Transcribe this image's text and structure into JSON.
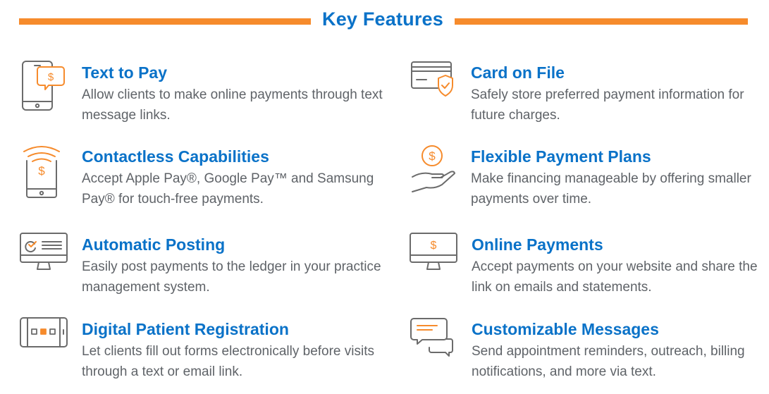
{
  "colors": {
    "accent": "#f68b2c",
    "brand": "#0a72c8",
    "text": "#5f6368",
    "icon_gray": "#6b6b6b"
  },
  "header": {
    "title": "Key Features"
  },
  "features": [
    {
      "icon": "phone-chat-dollar-icon",
      "title": "Text to Pay",
      "description": "Allow clients to make online payments through text message links."
    },
    {
      "icon": "credit-card-shield-icon",
      "title": "Card on File",
      "description": "Safely store preferred payment information for future charges."
    },
    {
      "icon": "phone-contactless-icon",
      "title": "Contactless Capabilities",
      "description": "Accept Apple Pay®, Google Pay™ and Samsung Pay® for touch-free payments."
    },
    {
      "icon": "hand-coin-icon",
      "title": "Flexible Payment Plans",
      "description": "Make financing manageable by offering smaller payments over time."
    },
    {
      "icon": "monitor-checklist-icon",
      "title": "Automatic Posting",
      "description": "Easily post payments to the ledger in your practice management system."
    },
    {
      "icon": "monitor-dollar-icon",
      "title": "Online Payments",
      "description": "Accept payments on your website and share the link on emails and statements."
    },
    {
      "icon": "tablet-form-icon",
      "title": "Digital Patient Registration",
      "description": "Let clients fill out forms electronically before visits through a text or email link."
    },
    {
      "icon": "chat-bubbles-icon",
      "title": "Customizable Messages",
      "description": "Send appointment reminders, outreach, billing notifications, and more via text."
    }
  ]
}
